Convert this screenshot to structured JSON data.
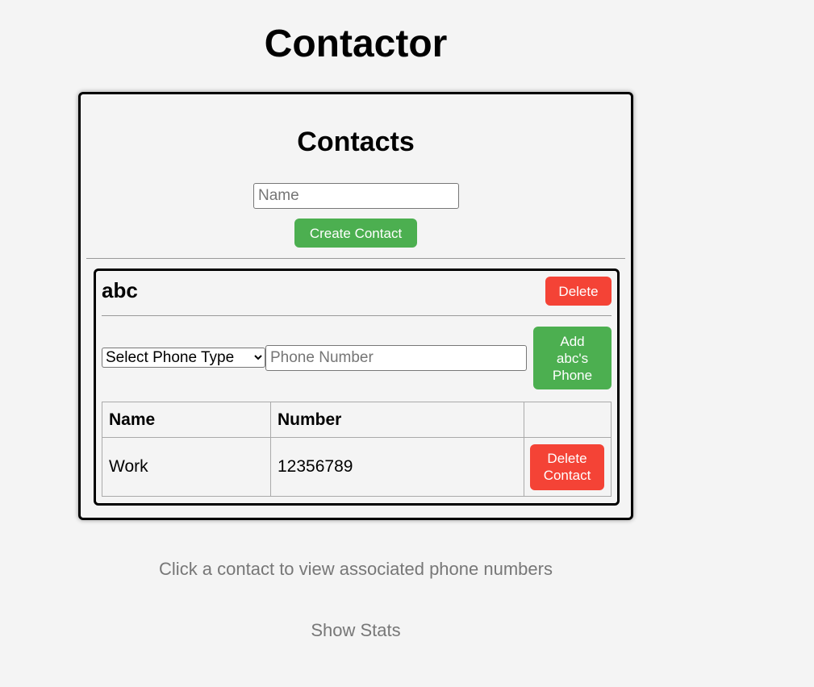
{
  "app": {
    "title": "Contactor"
  },
  "contacts": {
    "heading": "Contacts",
    "name_placeholder": "Name",
    "create_label": "Create Contact"
  },
  "contact": {
    "name": "abc",
    "delete_label": "Delete",
    "phone_type_selected": "Select Phone Type",
    "phone_placeholder": "Phone Number",
    "add_phone_label": "Add abc's Phone",
    "table": {
      "headers": [
        "Name",
        "Number",
        ""
      ],
      "rows": [
        {
          "name": "Work",
          "number": "12356789",
          "action": "Delete Contact"
        }
      ]
    }
  },
  "footer": {
    "hint": "Click a contact to view associated phone numbers",
    "stats_label": "Show Stats"
  }
}
